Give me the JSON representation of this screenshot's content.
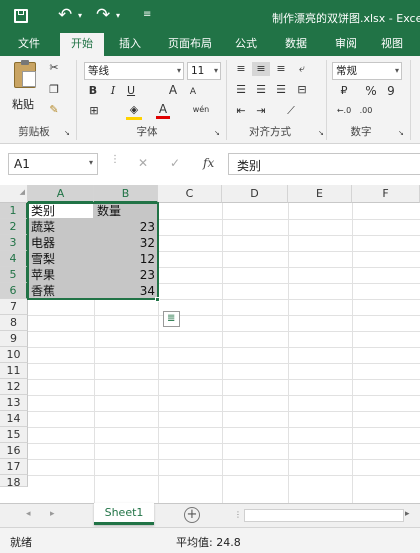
{
  "title": {
    "filename": "制作漂亮的双饼图.xlsx - Exce"
  },
  "tabs": [
    "文件",
    "开始",
    "插入",
    "页面布局",
    "公式",
    "数据",
    "审阅",
    "视图"
  ],
  "ribbon": {
    "clipboard": {
      "paste": "粘贴",
      "label": "剪贴板"
    },
    "font": {
      "name": "等线",
      "size": "11",
      "bold": "B",
      "italic": "I",
      "underline": "U",
      "grow": "A",
      "shrink": "A",
      "color_a": "A",
      "label": "字体"
    },
    "alignment": {
      "label": "对齐方式"
    },
    "number": {
      "format": "常规",
      "percent": "%",
      "comma": "9",
      "label": "数字"
    }
  },
  "formula_bar": {
    "name_box": "A1",
    "fx": "fx",
    "content": "类别"
  },
  "grid": {
    "columns": [
      "A",
      "B",
      "C",
      "D",
      "E",
      "F"
    ],
    "rows": [
      "1",
      "2",
      "3",
      "4",
      "5",
      "6",
      "7",
      "8",
      "9",
      "10",
      "11",
      "12",
      "13",
      "14",
      "15",
      "16",
      "17",
      "18"
    ],
    "header": {
      "a": "类别",
      "b": "数量"
    },
    "data": [
      {
        "category": "蔬菜",
        "qty": "23"
      },
      {
        "category": "电器",
        "qty": "32"
      },
      {
        "category": "雪梨",
        "qty": "12"
      },
      {
        "category": "苹果",
        "qty": "23"
      },
      {
        "category": "香蕉",
        "qty": "34"
      }
    ]
  },
  "sheets": {
    "active": "Sheet1"
  },
  "status": {
    "mode": "就绪",
    "average": "平均值: 24.8"
  },
  "colors": {
    "excel_green": "#217346",
    "selection": "#c6c6c6"
  }
}
